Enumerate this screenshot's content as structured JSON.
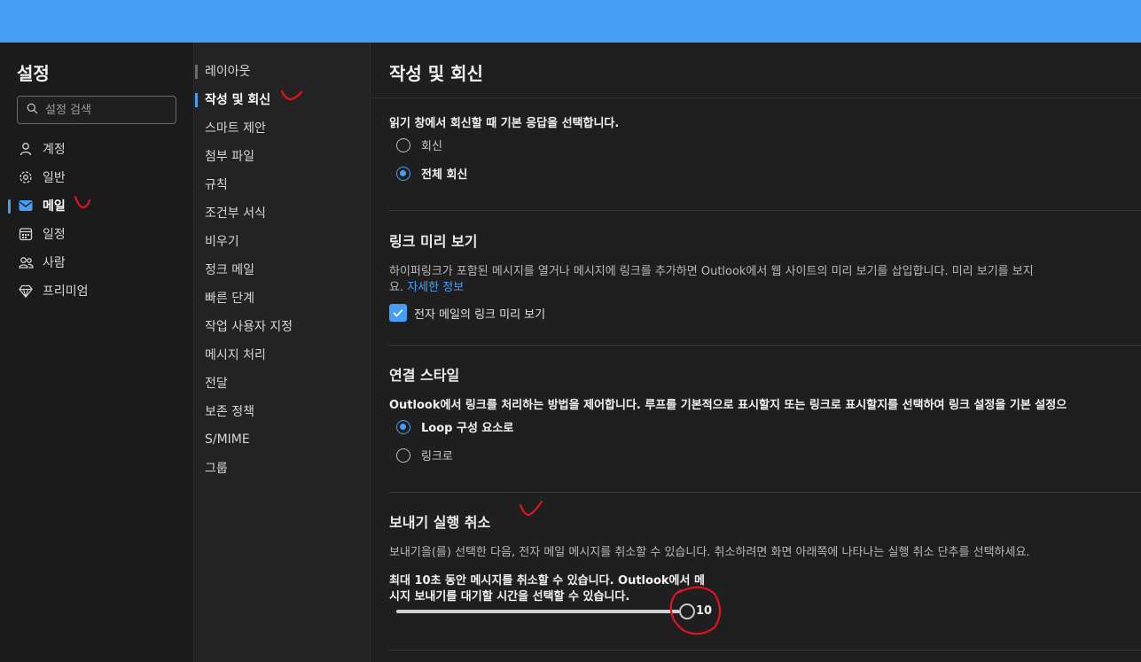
{
  "sidebar": {
    "title": "설정",
    "search_placeholder": "설정 검색",
    "items": [
      {
        "label": "계정",
        "icon": "person-icon"
      },
      {
        "label": "일반",
        "icon": "gear-icon"
      },
      {
        "label": "메일",
        "icon": "mail-icon",
        "active": true
      },
      {
        "label": "일정",
        "icon": "calendar-icon"
      },
      {
        "label": "사람",
        "icon": "people-icon"
      },
      {
        "label": "프리미엄",
        "icon": "diamond-icon"
      }
    ]
  },
  "subnav": {
    "items": [
      {
        "label": "레이아웃"
      },
      {
        "label": "작성 및 회신",
        "active": true
      },
      {
        "label": "스마트 제안"
      },
      {
        "label": "첨부 파일"
      },
      {
        "label": "규칙"
      },
      {
        "label": "조건부 서식"
      },
      {
        "label": "비우기"
      },
      {
        "label": "정크 메일"
      },
      {
        "label": "빠른 단계"
      },
      {
        "label": "작업 사용자 지정"
      },
      {
        "label": "메시지 처리"
      },
      {
        "label": "전달"
      },
      {
        "label": "보존 정책"
      },
      {
        "label": "S/MIME"
      },
      {
        "label": "그룹"
      }
    ]
  },
  "main": {
    "title": "작성 및 회신",
    "reply": {
      "prompt": "읽기 창에서 회신할 때 기본 응답을 선택합니다.",
      "options": [
        {
          "label": "회신",
          "selected": false
        },
        {
          "label": "전체 회신",
          "selected": true
        }
      ]
    },
    "link_preview": {
      "heading": "링크 미리 보기",
      "desc_line1": "하이퍼링크가 포함된 메시지를 열거나 메시지에 링크를 추가하면 Outlook에서 웹 사이트의 미리 보기를 삽입합니다. 미리 보기를 보지",
      "desc_line2_prefix": "요.",
      "learn_more": "자세한 정보",
      "checkbox_label": "전자 메일의 링크 미리 보기",
      "checked": true
    },
    "connection_style": {
      "heading": "연결 스타일",
      "desc": "Outlook에서 링크를 처리하는 방법을 제어합니다. 루프를 기본적으로 표시할지 또는 링크로 표시할지를 선택하여 링크 설정을 기본 설정으",
      "options": [
        {
          "label": "Loop 구성 요소로",
          "selected": true
        },
        {
          "label": "링크로",
          "selected": false
        }
      ]
    },
    "undo_send": {
      "heading": "보내기 실행 취소",
      "desc": "보내기을(를) 선택한 다음, 전자 메일 메시지를 취소할 수 있습니다. 취소하려면 화면 아래쪽에 나타나는 실행 취소 단추를 선택하세요.",
      "note_line1": "최대 10초 동안 메시지를 취소할 수 있습니다. Outlook에서 메",
      "note_line2": "시지 보내기를 대기할 시간을 선택할 수 있습니다.",
      "slider_value": "10",
      "slider_fraction": 1.0
    }
  },
  "colors": {
    "accent": "#479ef5",
    "annotation": "#e0141e"
  }
}
